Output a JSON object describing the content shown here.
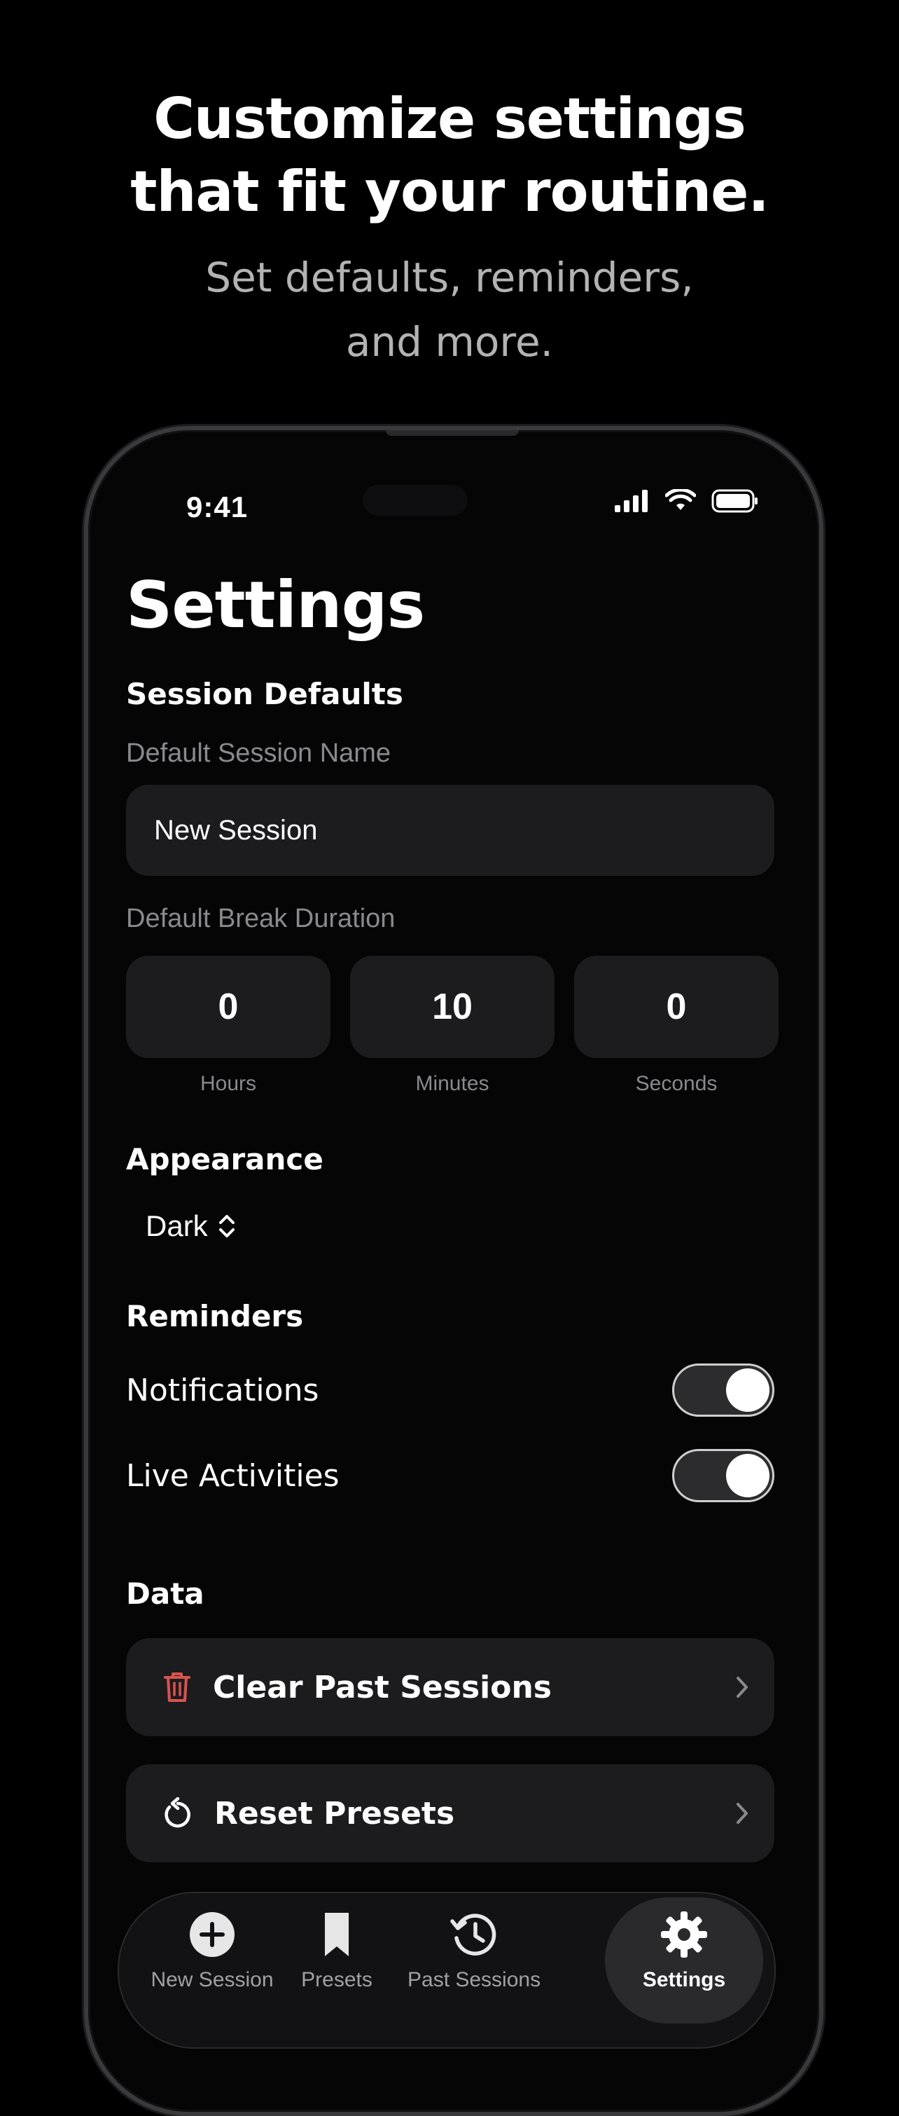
{
  "hero": {
    "title_line1": "Customize settings",
    "title_line2": "that fit your routine.",
    "subtitle_line1": "Set defaults, reminders,",
    "subtitle_line2": "and more."
  },
  "status_bar": {
    "time": "9:41"
  },
  "settings": {
    "title": "Settings",
    "session_defaults": {
      "header": "Session Defaults",
      "name_label": "Default Session Name",
      "name_value": "New Session",
      "break_label": "Default Break Duration",
      "break": [
        {
          "value": "0",
          "unit": "Hours"
        },
        {
          "value": "10",
          "unit": "Minutes"
        },
        {
          "value": "0",
          "unit": "Seconds"
        }
      ]
    },
    "appearance": {
      "header": "Appearance",
      "value": "Dark"
    },
    "reminders": {
      "header": "Reminders",
      "notifications_label": "Notifications",
      "notifications_on": true,
      "live_activities_label": "Live Activities",
      "live_activities_on": true
    },
    "data": {
      "header": "Data",
      "clear_label": "Clear Past Sessions",
      "reset_label": "Reset Presets"
    }
  },
  "tabbar": {
    "tabs": [
      {
        "label": "New Session",
        "icon": "plus-circle-icon"
      },
      {
        "label": "Presets",
        "icon": "bookmark-icon"
      },
      {
        "label": "Past Sessions",
        "icon": "history-clock-icon"
      },
      {
        "label": "Settings",
        "icon": "gear-icon",
        "active": true
      }
    ]
  },
  "colors": {
    "background": "#000000",
    "card": "#1c1c1e",
    "secondary_text": "#8a8a8e",
    "trash_icon": "#d9534f"
  }
}
